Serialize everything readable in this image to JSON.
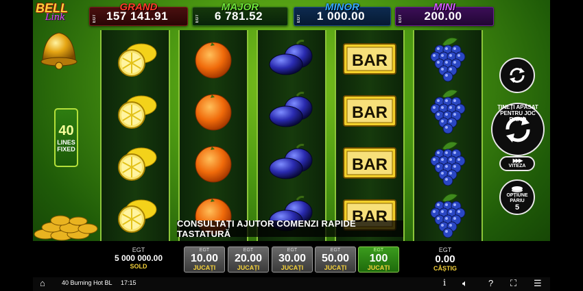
{
  "jackpots": [
    {
      "name": "GRAND",
      "value": "157 141.91",
      "tag": "EGT"
    },
    {
      "name": "MAJOR",
      "value": "6 781.52",
      "tag": "EGT"
    },
    {
      "name": "MINOR",
      "value": "1 000.00",
      "tag": "EGT"
    },
    {
      "name": "MINI",
      "value": "200.00",
      "tag": "EGT"
    }
  ],
  "logo": {
    "line1": "BELL",
    "line2": "Link"
  },
  "lines": {
    "count": "40",
    "label1": "LINES",
    "label2": "FIXED"
  },
  "reels": [
    {
      "symbol": "lemon",
      "rows": 4
    },
    {
      "symbol": "orange",
      "rows": 4
    },
    {
      "symbol": "plum",
      "rows": 4
    },
    {
      "symbol": "bar",
      "rows": 4,
      "text": "BAR"
    },
    {
      "symbol": "grapes",
      "rows": 4
    }
  ],
  "info_message": "CONSULTAȚI AJUTOR COMENZI RAPIDE TASTATURĂ",
  "controls": {
    "spin_hint": "ȚINEȚI APĂSAT PENTRU JOC RAPID",
    "speed_label": "VITEZA",
    "options_label1": "OPȚIUNE",
    "options_label2": "PARIU",
    "options_value": "5"
  },
  "balance": {
    "tag": "EGT",
    "value": "5 000 000.00",
    "label": "SOLD"
  },
  "bets": [
    {
      "tag": "EGT",
      "amount": "10.00",
      "label": "JUCAȚI",
      "active": false
    },
    {
      "tag": "EGT",
      "amount": "20.00",
      "label": "JUCAȚI",
      "active": false
    },
    {
      "tag": "EGT",
      "amount": "30.00",
      "label": "JUCAȚI",
      "active": false
    },
    {
      "tag": "EGT",
      "amount": "50.00",
      "label": "JUCAȚI",
      "active": false
    },
    {
      "tag": "EGT",
      "amount": "100",
      "label": "JUCAȚI",
      "active": true
    }
  ],
  "win": {
    "tag": "EGT",
    "value": "0.00",
    "label": "CÂȘTIG"
  },
  "status_bar": {
    "game_name": "40 Burning Hot BL",
    "time": "17:15"
  },
  "colors": {
    "grand": "#ff3a2a",
    "major": "#6fe53a",
    "minor": "#34a9ff",
    "mini": "#d35bff",
    "accent_gold": "#f5d23a",
    "active_bet": "#3b9c1d"
  }
}
